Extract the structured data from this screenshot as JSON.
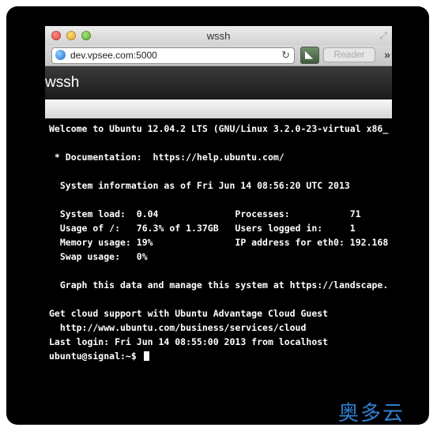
{
  "browser": {
    "window_title": "wssh",
    "url": "dev.vpsee.com:5000",
    "reader_label": "Reader"
  },
  "app": {
    "brand": "wssh"
  },
  "terminal": {
    "lines": [
      "Welcome to Ubuntu 12.04.2 LTS (GNU/Linux 3.2.0-23-virtual x86_",
      "",
      " * Documentation:  https://help.ubuntu.com/",
      "",
      "  System information as of Fri Jun 14 08:56:20 UTC 2013",
      "",
      "  System load:  0.04              Processes:           71",
      "  Usage of /:   76.3% of 1.37GB   Users logged in:     1",
      "  Memory usage: 19%               IP address for eth0: 192.168",
      "  Swap usage:   0%",
      "",
      "  Graph this data and manage this system at https://landscape.",
      "",
      "Get cloud support with Ubuntu Advantage Cloud Guest",
      "  http://www.ubuntu.com/business/services/cloud",
      "Last login: Fri Jun 14 08:55:00 2013 from localhost"
    ],
    "prompt": "ubuntu@signal:~$ "
  },
  "watermark": "奥多云"
}
